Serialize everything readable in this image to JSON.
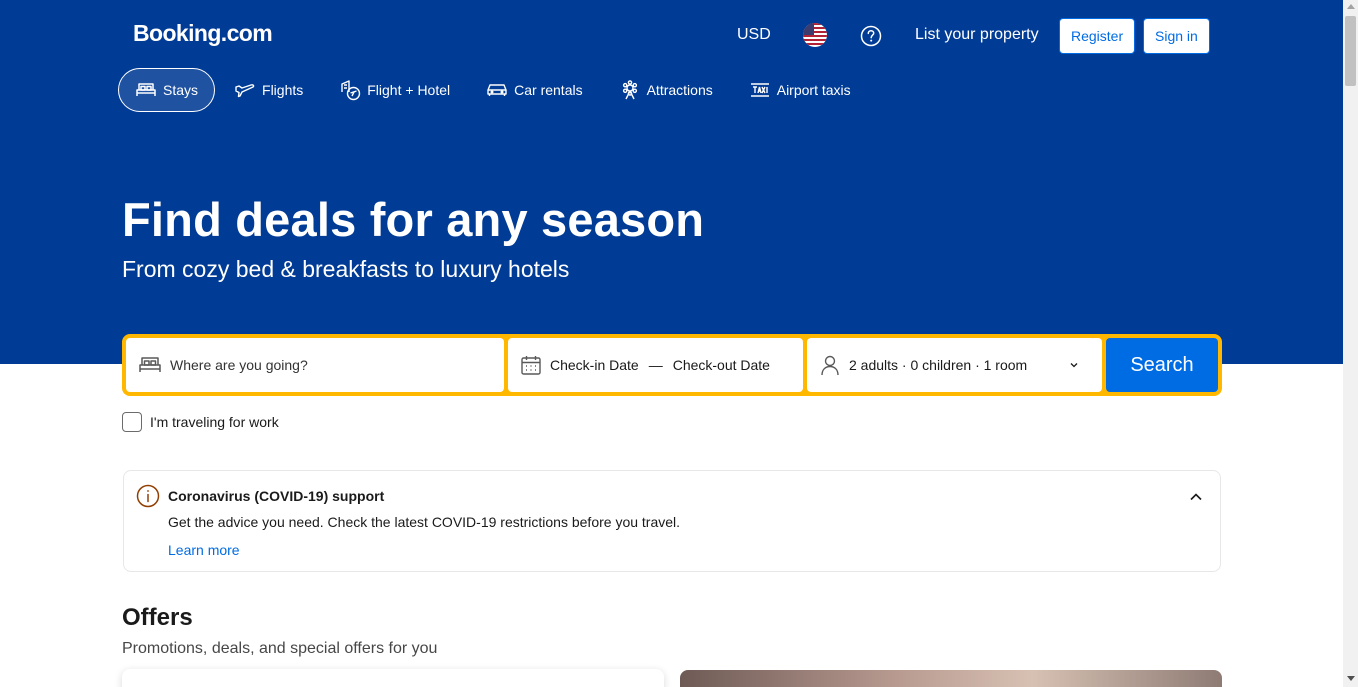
{
  "header": {
    "logo": "Booking.com",
    "currency": "USD",
    "flag_icon": "us-flag-icon",
    "help_icon": "question-circle-icon",
    "list_property": "List your property",
    "register": "Register",
    "sign_in": "Sign in"
  },
  "nav": {
    "tabs": [
      {
        "label": "Stays",
        "icon": "bed-icon",
        "active": true
      },
      {
        "label": "Flights",
        "icon": "plane-icon",
        "active": false
      },
      {
        "label": "Flight + Hotel",
        "icon": "flight-hotel-icon",
        "active": false
      },
      {
        "label": "Car rentals",
        "icon": "car-icon",
        "active": false
      },
      {
        "label": "Attractions",
        "icon": "attractions-icon",
        "active": false
      },
      {
        "label": "Airport taxis",
        "icon": "taxi-icon",
        "active": false
      }
    ]
  },
  "hero": {
    "title": "Find deals for any season",
    "subtitle": "From cozy bed & breakfasts to luxury hotels"
  },
  "search": {
    "destination_placeholder": "Where are you going?",
    "checkin": "Check-in Date",
    "date_separator": "—",
    "checkout": "Check-out Date",
    "guests": "2 adults · 0 children · 1 room",
    "button": "Search"
  },
  "work_travel": {
    "label": "I'm traveling for work",
    "checked": false
  },
  "covid": {
    "title": "Coronavirus (COVID-19) support",
    "text": "Get the advice you need. Check the latest COVID-19 restrictions before you travel.",
    "link": "Learn more"
  },
  "offers": {
    "title": "Offers",
    "subtitle": "Promotions, deals, and special offers for you"
  },
  "colors": {
    "brand_blue": "#003b95",
    "action_blue": "#006ce4",
    "search_border": "#ffb700",
    "info_icon": "#923e01"
  }
}
